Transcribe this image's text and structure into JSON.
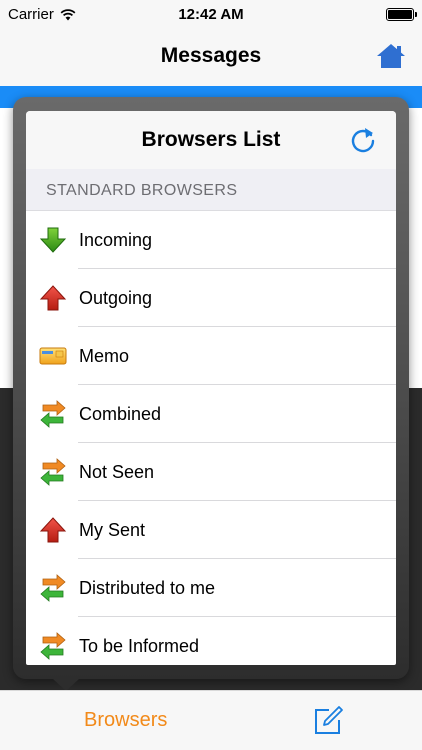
{
  "status_bar": {
    "carrier": "Carrier",
    "time": "12:42 AM",
    "wifi_icon": "wifi-icon",
    "battery_icon": "battery-icon"
  },
  "nav_bar": {
    "title": "Messages",
    "home_icon": "home-icon",
    "accent_color": "#2f6fd1"
  },
  "popover": {
    "title": "Browsers List",
    "refresh_icon": "refresh-icon",
    "section_header": "STANDARD BROWSERS",
    "items": [
      {
        "label": "Incoming",
        "icon": "arrow-down-icon"
      },
      {
        "label": "Outgoing",
        "icon": "arrow-up-icon"
      },
      {
        "label": "Memo",
        "icon": "memo-icon"
      },
      {
        "label": "Combined",
        "icon": "exchange-icon"
      },
      {
        "label": "Not Seen",
        "icon": "exchange-icon"
      },
      {
        "label": "My Sent",
        "icon": "arrow-up-icon"
      },
      {
        "label": "Distributed to me",
        "icon": "exchange-icon"
      },
      {
        "label": "To be Informed",
        "icon": "exchange-icon"
      }
    ]
  },
  "tab_bar": {
    "browsers_label": "Browsers",
    "compose_icon": "compose-icon",
    "active_color": "#f28a1a",
    "tint_color": "#1a7fe0"
  }
}
